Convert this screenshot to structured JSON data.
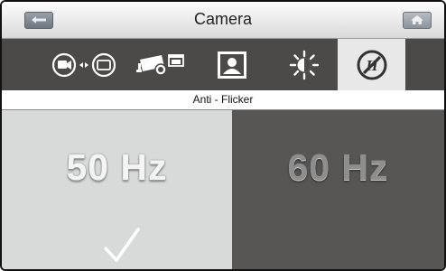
{
  "header": {
    "title": "Camera"
  },
  "toolbar": {
    "tools": [
      {
        "icon": "camera-switch-icon",
        "active": false
      },
      {
        "icon": "camera-record-icon",
        "active": false
      },
      {
        "icon": "portrait-icon",
        "active": false
      },
      {
        "icon": "brightness-icon",
        "active": false
      },
      {
        "icon": "anti-flicker-icon",
        "active": true
      }
    ]
  },
  "section": {
    "title": "Anti - Flicker"
  },
  "options": [
    {
      "label": "50 Hz",
      "selected": true
    },
    {
      "label": "60 Hz",
      "selected": false
    }
  ],
  "colors": {
    "selected_bg": "#d8dada",
    "unselected_bg": "#575655",
    "toolbar_bg": "#4b4a49"
  }
}
